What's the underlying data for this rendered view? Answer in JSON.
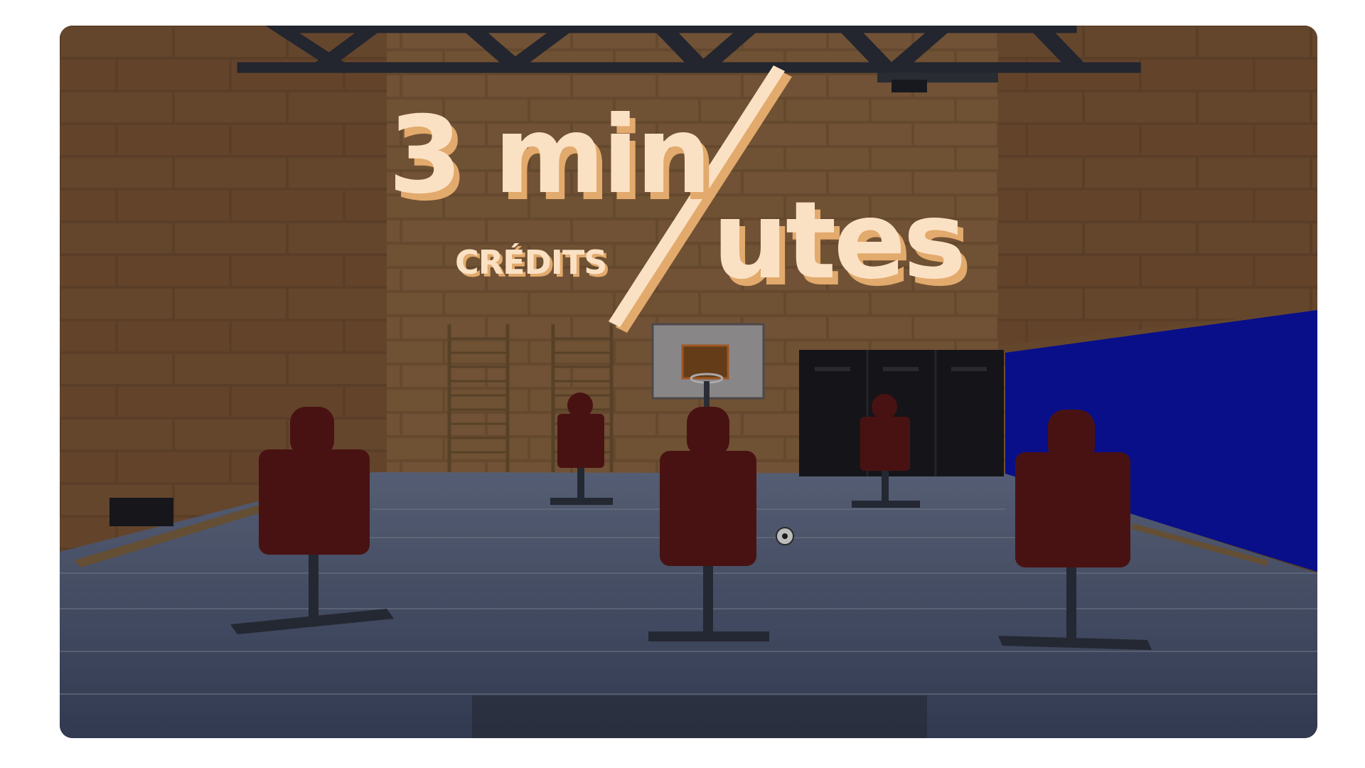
{
  "game": {
    "title_part1": "3 min",
    "title_part2": "utes",
    "subtitle": "CRÉDITS"
  },
  "colors": {
    "title_fill": "#fbe1c4",
    "title_shadow": "#e2aa6c",
    "wall_brick": "#7a5535",
    "floor": "#4f5b7a",
    "target": "#5a1616",
    "blue_wall": "#0a13a8",
    "lockers": "#1a1a1f"
  }
}
